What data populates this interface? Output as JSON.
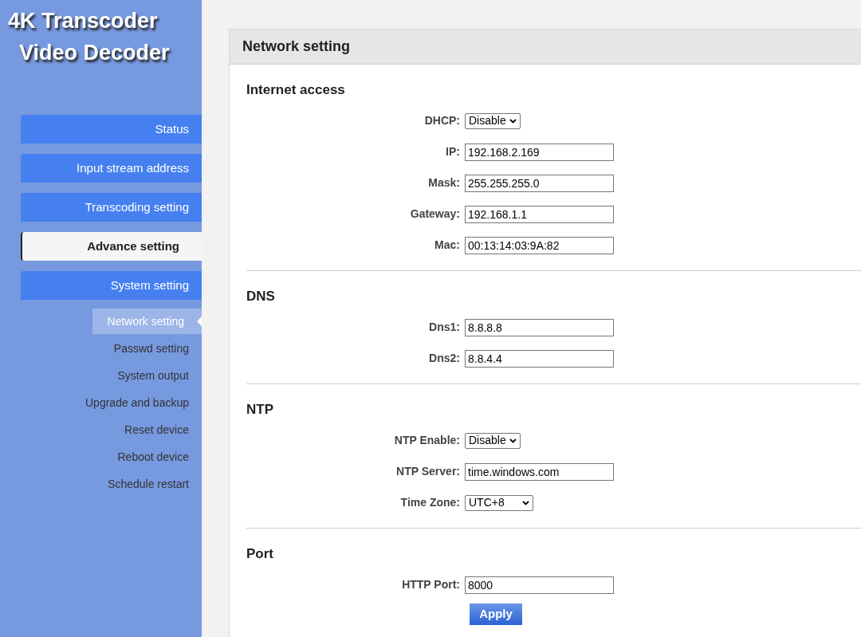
{
  "logo": {
    "lines": [
      "4K Transcoder",
      "Video Decoder"
    ]
  },
  "nav": [
    {
      "label": "Status",
      "selected": false
    },
    {
      "label": "Input stream address",
      "selected": false
    },
    {
      "label": "Transcoding setting",
      "selected": false
    },
    {
      "label": "Advance setting",
      "selected": true
    },
    {
      "label": "System setting",
      "selected": false
    }
  ],
  "subnav": [
    {
      "label": "Network setting",
      "selected": true
    },
    {
      "label": "Passwd setting",
      "selected": false
    },
    {
      "label": "System output",
      "selected": false
    },
    {
      "label": "Upgrade and backup",
      "selected": false
    },
    {
      "label": "Reset device",
      "selected": false
    },
    {
      "label": "Reboot device",
      "selected": false
    },
    {
      "label": "Schedule restart",
      "selected": false
    }
  ],
  "panel": {
    "title": "Network setting",
    "sections": [
      {
        "title": "Internet access",
        "fields": [
          {
            "kind": "select",
            "label": "DHCP:",
            "value": "Disable"
          },
          {
            "kind": "text",
            "label": "IP:",
            "value": "192.168.2.169"
          },
          {
            "kind": "text",
            "label": "Mask:",
            "value": "255.255.255.0"
          },
          {
            "kind": "text",
            "label": "Gateway:",
            "value": "192.168.1.1"
          },
          {
            "kind": "text",
            "label": "Mac:",
            "value": "00:13:14:03:9A:82"
          }
        ]
      },
      {
        "title": "DNS",
        "fields": [
          {
            "kind": "text",
            "label": "Dns1:",
            "value": "8.8.8.8"
          },
          {
            "kind": "text",
            "label": "Dns2:",
            "value": "8.8.4.4"
          }
        ]
      },
      {
        "title": "NTP",
        "fields": [
          {
            "kind": "select",
            "label": "NTP Enable:",
            "value": "Disable"
          },
          {
            "kind": "text",
            "label": "NTP Server:",
            "value": "time.windows.com"
          },
          {
            "kind": "select",
            "label": "Time Zone:",
            "value": "UTC+8",
            "wide": true
          }
        ]
      },
      {
        "title": "Port",
        "fields": [
          {
            "kind": "text",
            "label": "HTTP Port:",
            "value": "8000"
          }
        ]
      }
    ],
    "apply": "Apply"
  }
}
